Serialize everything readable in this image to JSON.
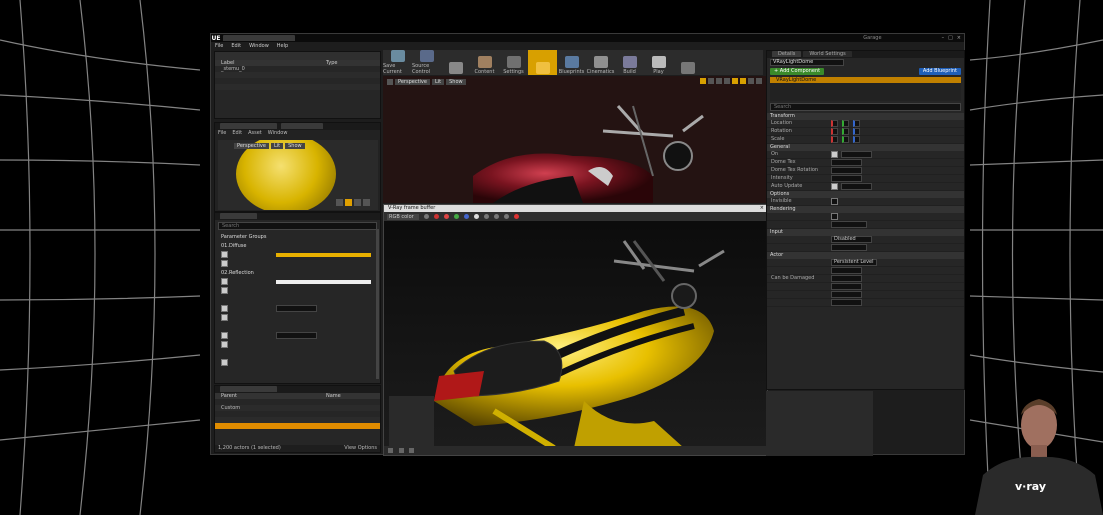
{
  "window": {
    "title": "Garage",
    "logo": "UE"
  },
  "menu": [
    "File",
    "Edit",
    "Window",
    "Help"
  ],
  "world_outliner": {
    "columns": [
      "Label",
      "Type"
    ],
    "rows": [
      {
        "label": "_stemu_0",
        "type": ""
      },
      {
        "label": "",
        "type": ""
      },
      {
        "label": "",
        "type": ""
      },
      {
        "label": "",
        "type": ""
      },
      {
        "label": "",
        "type": ""
      }
    ]
  },
  "material_editor": {
    "menu": [
      "File",
      "Edit",
      "Asset",
      "Window"
    ],
    "view_buttons": [
      "Perspective",
      "Lit",
      "Show"
    ]
  },
  "settings_panel": {
    "search_placeholder": "Search",
    "items": [
      {
        "label": "Parameter Groups",
        "kind": "group"
      },
      {
        "label": "01.Diffuse",
        "kind": "group"
      },
      {
        "label": "",
        "kind": "slider"
      },
      {
        "label": "",
        "kind": "check"
      },
      {
        "label": "02.Reflection",
        "kind": "group"
      },
      {
        "label": "",
        "kind": "slider-white"
      },
      {
        "label": "",
        "kind": "check"
      },
      {
        "label": "",
        "kind": "group"
      },
      {
        "label": "",
        "kind": "value"
      },
      {
        "label": "",
        "kind": "check"
      },
      {
        "label": "",
        "kind": "group"
      },
      {
        "label": "",
        "kind": "value"
      },
      {
        "label": "",
        "kind": "check"
      },
      {
        "label": "",
        "kind": "group"
      },
      {
        "label": "",
        "kind": "check"
      },
      {
        "label": "",
        "kind": "group"
      }
    ]
  },
  "scene_outliner": {
    "columns": [
      "Parent",
      "Name"
    ],
    "rows": [
      {
        "parent": "",
        "name": "",
        "sel": false
      },
      {
        "parent": "Custom",
        "name": "",
        "sel": false
      },
      {
        "parent": "",
        "name": "",
        "sel": false
      },
      {
        "parent": "",
        "name": "",
        "sel": false
      },
      {
        "parent": "",
        "name": "",
        "sel": true
      }
    ],
    "footer": "1,200 actors (1 selected)",
    "view_options": "View Options"
  },
  "toolbar": [
    {
      "label": "Save Current",
      "color": "#6a8ca0"
    },
    {
      "label": "Source Control",
      "color": "#5a6a8a"
    },
    {
      "label": "",
      "color": "#888888"
    },
    {
      "label": "Content",
      "color": "#a08060"
    },
    {
      "label": "Settings",
      "color": "#707070"
    },
    {
      "label": "",
      "color": "#f0c040"
    },
    {
      "label": "Blueprints",
      "color": "#5a7aa0"
    },
    {
      "label": "Cinematics",
      "color": "#909090"
    },
    {
      "label": "Build",
      "color": "#7a7a9a"
    },
    {
      "label": "Play",
      "color": "#bbbbbb"
    },
    {
      "label": "",
      "color": "#777777"
    }
  ],
  "viewport": {
    "buttons": [
      "Perspective",
      "Lit",
      "Show"
    ],
    "notice": ""
  },
  "vfb": {
    "title": "V-Ray frame buffer",
    "channel": "RGB color"
  },
  "details": {
    "tabs": [
      "Details",
      "World Settings"
    ],
    "selected": "VRayLightDome",
    "add_component": "+ Add Component",
    "add_blueprint": "Add Blueprint",
    "component_tree": [
      "VRayLightDome",
      "",
      ""
    ],
    "search_placeholder": "Search",
    "transform": {
      "header": "Transform",
      "location": {
        "label": "Location",
        "x": "",
        "y": "",
        "z": ""
      },
      "rotation": {
        "label": "Rotation",
        "x": "",
        "y": "",
        "z": ""
      },
      "scale": {
        "label": "Scale",
        "x": "",
        "y": "",
        "z": ""
      }
    },
    "general": {
      "header": "General",
      "props": [
        {
          "label": "On",
          "value": "",
          "check": true
        },
        {
          "label": "Dome Tex",
          "value": "",
          "check": false
        },
        {
          "label": "Dome Tex Rotation",
          "value": "",
          "check": false
        },
        {
          "label": "Intensity",
          "value": "",
          "check": false
        },
        {
          "label": "Auto Update",
          "value": "",
          "check": true
        }
      ]
    },
    "options": {
      "header": "Options",
      "props": [
        {
          "label": "Invisible",
          "value": ""
        }
      ]
    },
    "rendering": {
      "header": "Rendering",
      "props": [
        {
          "label": "",
          "value": ""
        },
        {
          "label": "",
          "value": ""
        }
      ]
    },
    "input": {
      "header": "Input",
      "props": [
        {
          "label": "",
          "value": "Disabled"
        },
        {
          "label": "",
          "value": ""
        }
      ]
    },
    "actor": {
      "header": "Actor",
      "props": [
        {
          "label": "",
          "value": "Persistent Level"
        },
        {
          "label": "",
          "value": ""
        },
        {
          "label": "Can be Damaged",
          "value": ""
        },
        {
          "label": "",
          "value": ""
        },
        {
          "label": "",
          "value": ""
        },
        {
          "label": "",
          "value": ""
        }
      ]
    }
  },
  "brand": {
    "logo_text": "v·ray"
  },
  "colors": {
    "accent": "#e8a000",
    "panel": "#262626",
    "frame": "#1d1d1d"
  }
}
